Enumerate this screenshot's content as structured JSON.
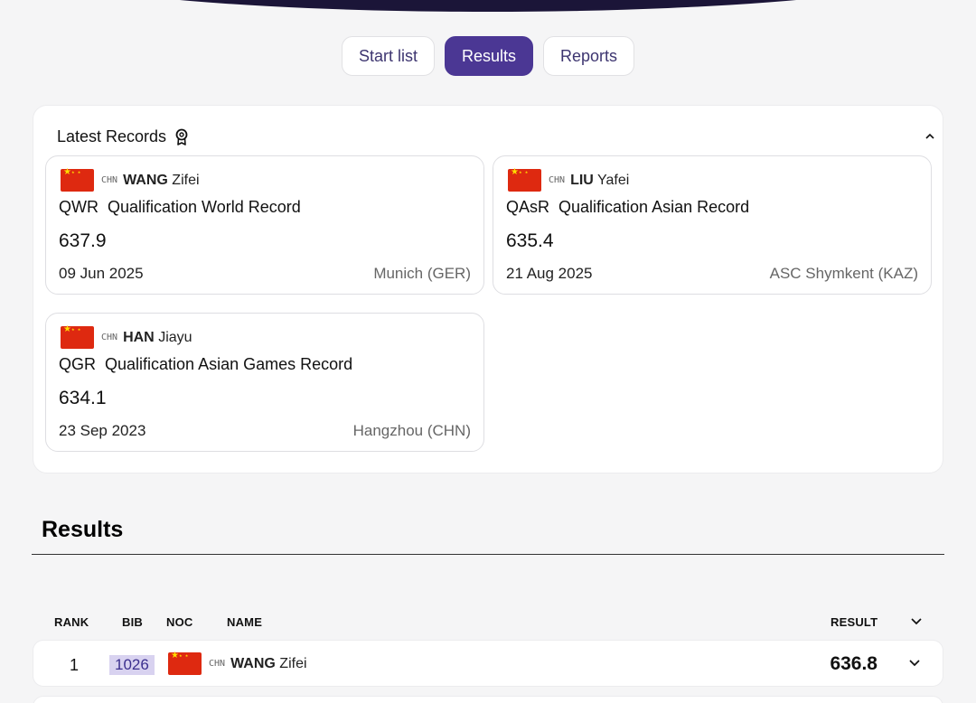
{
  "tabs": [
    {
      "label": "Start list",
      "active": false
    },
    {
      "label": "Results",
      "active": true
    },
    {
      "label": "Reports",
      "active": false
    }
  ],
  "latest_records": {
    "title": "Latest Records",
    "cards": [
      {
        "noc": "CHN",
        "surname": "WANG",
        "given_name": "Zifei",
        "record_code": "QWR",
        "record_name": "Qualification World Record",
        "value": "637.9",
        "date": "09 Jun 2025",
        "place": "Munich (GER)"
      },
      {
        "noc": "CHN",
        "surname": "LIU",
        "given_name": "Yafei",
        "record_code": "QAsR",
        "record_name": "Qualification Asian Record",
        "value": "635.4",
        "date": "21 Aug 2025",
        "place": "ASC Shymkent (KAZ)"
      },
      {
        "noc": "CHN",
        "surname": "HAN",
        "given_name": "Jiayu",
        "record_code": "QGR",
        "record_name": "Qualification Asian Games Record",
        "value": "634.1",
        "date": "23 Sep 2023",
        "place": "Hangzhou (CHN)"
      }
    ]
  },
  "results": {
    "title": "Results",
    "columns": {
      "rank": "RANK",
      "bib": "BIB",
      "noc": "NOC",
      "name": "NAME",
      "result": "RESULT"
    },
    "rows": [
      {
        "rank": "1",
        "bib": "1026",
        "noc": "CHN",
        "surname": "WANG",
        "given_name": "Zifei",
        "result": "636.8"
      }
    ]
  },
  "colors": {
    "accent": "#4b3794",
    "bib_bg": "#d8d2f0",
    "flag_red": "#de2910"
  }
}
